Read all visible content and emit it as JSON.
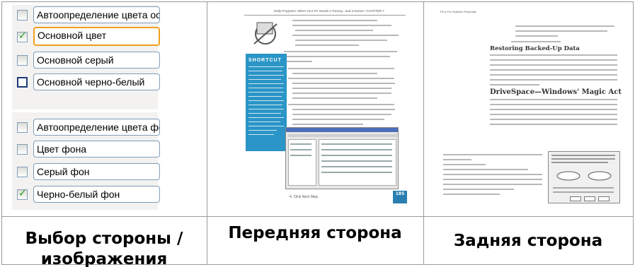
{
  "left_panel": {
    "group1": [
      {
        "label": "Автоопределение цвета осн",
        "checked": false,
        "selected": false
      },
      {
        "label": "Основной цвет",
        "checked": true,
        "selected": true
      },
      {
        "label": "Основной серый",
        "checked": false,
        "selected": false
      },
      {
        "label": "Основной черно-белый",
        "checked": false,
        "selected": false
      }
    ],
    "group2": [
      {
        "label": "Автоопределение цвета фо",
        "checked": false
      },
      {
        "label": "Цвет фона",
        "checked": false
      },
      {
        "label": "Серый фон",
        "checked": false
      },
      {
        "label": "Черно-белый фон",
        "checked": true
      }
    ]
  },
  "captions": {
    "left_line1": "Выбор стороны /",
    "left_line2": "изображения",
    "middle": "Передняя сторона",
    "right": "Задняя сторона"
  },
  "front_page": {
    "header": "Daily Programs: When Your PC Needs a Tuneup...and a Doctor • CHAPTER 7",
    "sidebar_title": "SHORTCUT",
    "page_number": "185",
    "footer": "4. Click Next Step."
  },
  "back_page": {
    "header": "PC ▸ For Scanner Personals",
    "heading1": "Restoring Backed-Up Data",
    "heading2": "DriveSpace—Windows' Magic Act"
  },
  "colors": {
    "accent_selected": "#f0a020",
    "sidebar_blue": "#2a95c6",
    "check_green": "#21a121"
  }
}
